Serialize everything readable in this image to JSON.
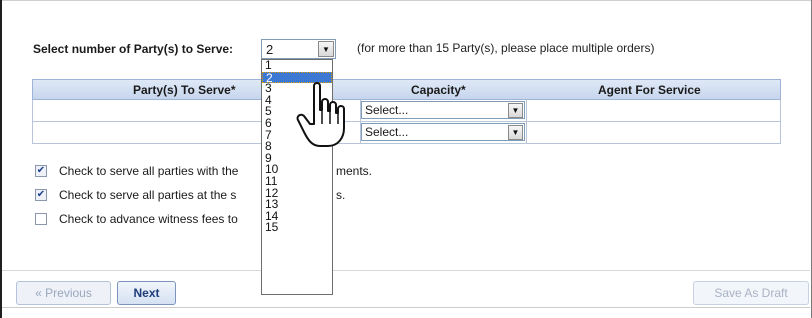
{
  "form": {
    "select_label": "Select number of Party(s) to Serve:",
    "selected_value": "2",
    "hint": "(for more than 15 Party(s), please place multiple orders)"
  },
  "dropdown": {
    "options": [
      "1",
      "2",
      "3",
      "4",
      "5",
      "6",
      "7",
      "8",
      "9",
      "10",
      "11",
      "12",
      "13",
      "14",
      "15"
    ],
    "selected": "2"
  },
  "table": {
    "headers": [
      "Party(s) To Serve*",
      "Capacity*",
      "Agent For Service"
    ],
    "rows": [
      {
        "party": "",
        "capacity": "Select...",
        "agent": ""
      },
      {
        "party": "",
        "capacity": "Select...",
        "agent": ""
      }
    ]
  },
  "checkboxes": [
    {
      "label": "Check to serve all parties with the",
      "tail": "ments.",
      "checked": true
    },
    {
      "label": "Check to serve all parties at the s",
      "tail": "s.",
      "checked": true
    },
    {
      "label": "Check to advance witness fees to",
      "tail": "",
      "checked": false
    }
  ],
  "buttons": {
    "previous": "« Previous",
    "next": "Next",
    "save_draft": "Save As Draft"
  },
  "icons": {
    "dropdown_arrow": "chevron-down-icon",
    "cursor": "hand-pointer-icon"
  }
}
